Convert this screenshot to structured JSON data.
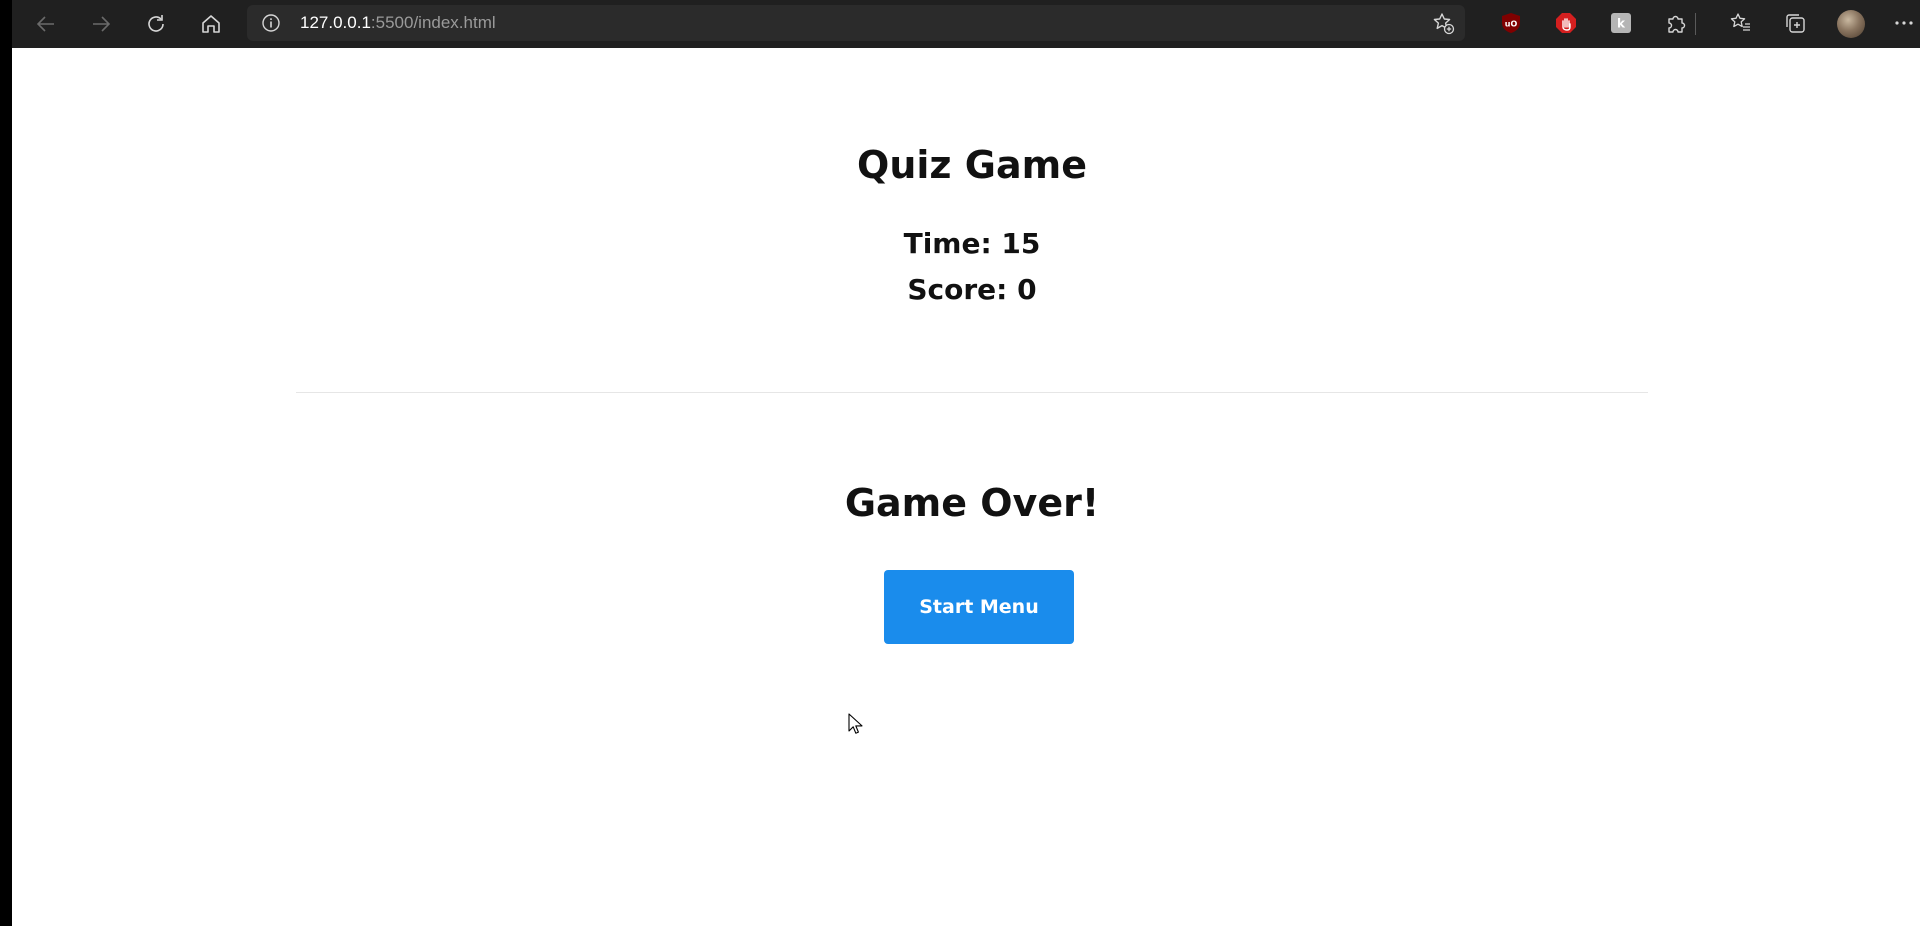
{
  "browser": {
    "url_host": "127.0.0.1",
    "url_path": ":5500/index.html",
    "icons": {
      "back": "arrow-left-icon",
      "forward": "arrow-right-icon",
      "refresh": "refresh-icon",
      "home": "home-icon",
      "info": "info-icon",
      "add_favorite": "star-add-icon",
      "extensions": [
        "ublock-origin-icon",
        "adblock-hand-icon",
        "extension-k-icon"
      ],
      "extensions_menu": "puzzle-icon",
      "favorites": "favorites-icon",
      "collections": "collections-icon",
      "more": "more-icon"
    },
    "colors": {
      "toolbar": "#202020",
      "address_bar": "#2b2b2b"
    }
  },
  "page": {
    "title": "Quiz Game",
    "time_label": "Time: 15",
    "score_label": "Score: 0",
    "game_over": "Game Over!",
    "start_menu_button": "Start Menu",
    "colors": {
      "button": "#1a8cec",
      "background": "#ffffff"
    }
  }
}
